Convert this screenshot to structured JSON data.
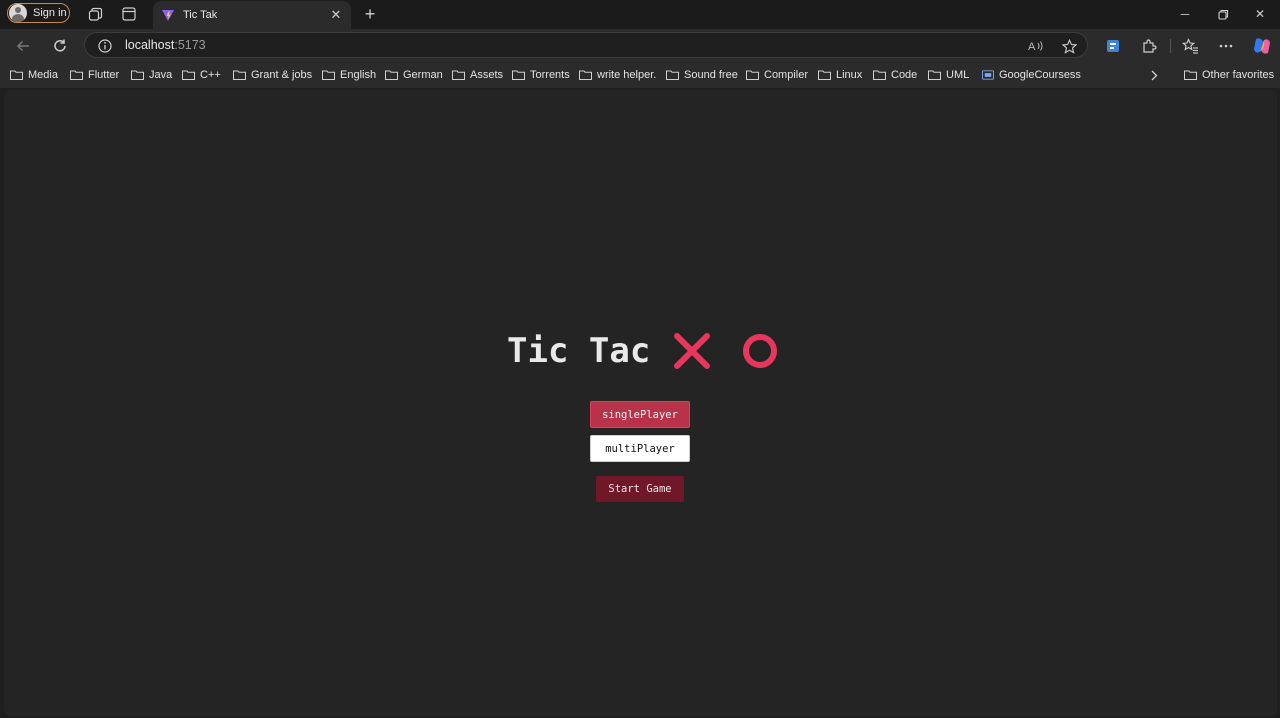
{
  "browser": {
    "profile_label": "Sign in",
    "tab_title": "Tic Tak",
    "url_host": "localhost",
    "url_port": ":5173",
    "bookmarks": [
      "Media",
      "Flutter",
      "Java",
      "C++",
      "Grant & jobs",
      "English",
      "German",
      "Assets",
      "Torrents",
      "write helper.",
      "Sound free",
      "Compiler",
      "Linux",
      "Code",
      "UML",
      "GoogleCoursess"
    ],
    "other_favorites": "Other favorites",
    "accent_color": "#c98a4f"
  },
  "game": {
    "title": "Tic Tac",
    "mark_color": "#e8375c",
    "modes": {
      "single_label": "singlePlayer",
      "multi_label": "multiPlayer",
      "selected": "singlePlayer"
    },
    "start_label": "Start Game"
  }
}
